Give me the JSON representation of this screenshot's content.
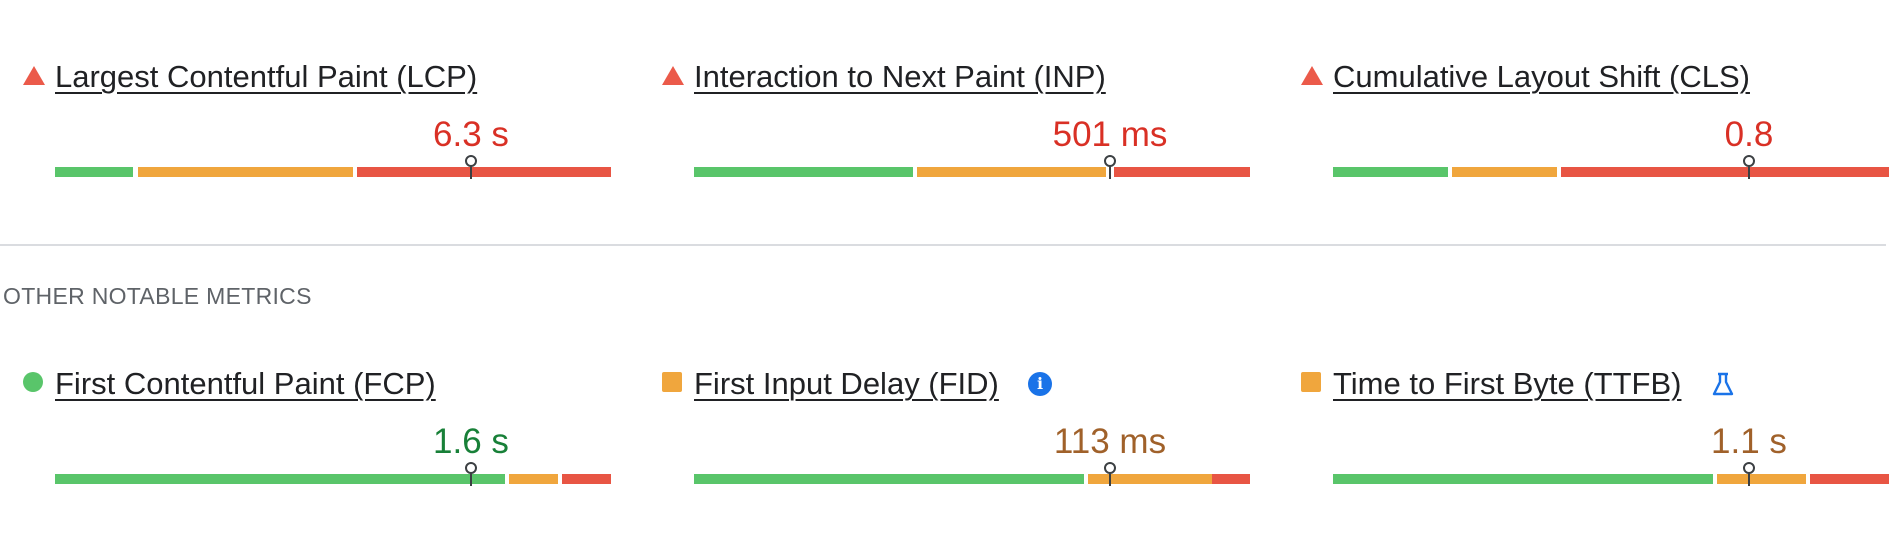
{
  "core_metrics": [
    {
      "name": "Largest Contentful Paint (LCP)",
      "value": "6.3 s",
      "status": "poor",
      "marker_fraction": 0.75
    },
    {
      "name": "Interaction to Next Paint (INP)",
      "value": "501 ms",
      "status": "poor",
      "marker_fraction": 0.75
    },
    {
      "name": "Cumulative Layout Shift (CLS)",
      "value": "0.8",
      "status": "poor",
      "marker_fraction": 0.75
    }
  ],
  "section_heading": "OTHER NOTABLE METRICS",
  "other_metrics": [
    {
      "name": "First Contentful Paint (FCP)",
      "value": "1.6 s",
      "status": "good",
      "marker_fraction": 0.75
    },
    {
      "name": "First Input Delay (FID)",
      "value": "113 ms",
      "status": "needs-improvement",
      "marker_fraction": 0.75,
      "badge_icon": "info-icon"
    },
    {
      "name": "Time to First Byte (TTFB)",
      "value": "1.1 s",
      "status": "needs-improvement",
      "marker_fraction": 0.75,
      "badge_icon": "experimental-flask-icon"
    }
  ],
  "colors": {
    "good": "#59c56a",
    "needs_improvement": "#f0a63d",
    "poor": "#e85544",
    "poor_text": "#d93025",
    "good_text": "#188038",
    "ni_text": "#a0612a",
    "info": "#1a73e8"
  }
}
